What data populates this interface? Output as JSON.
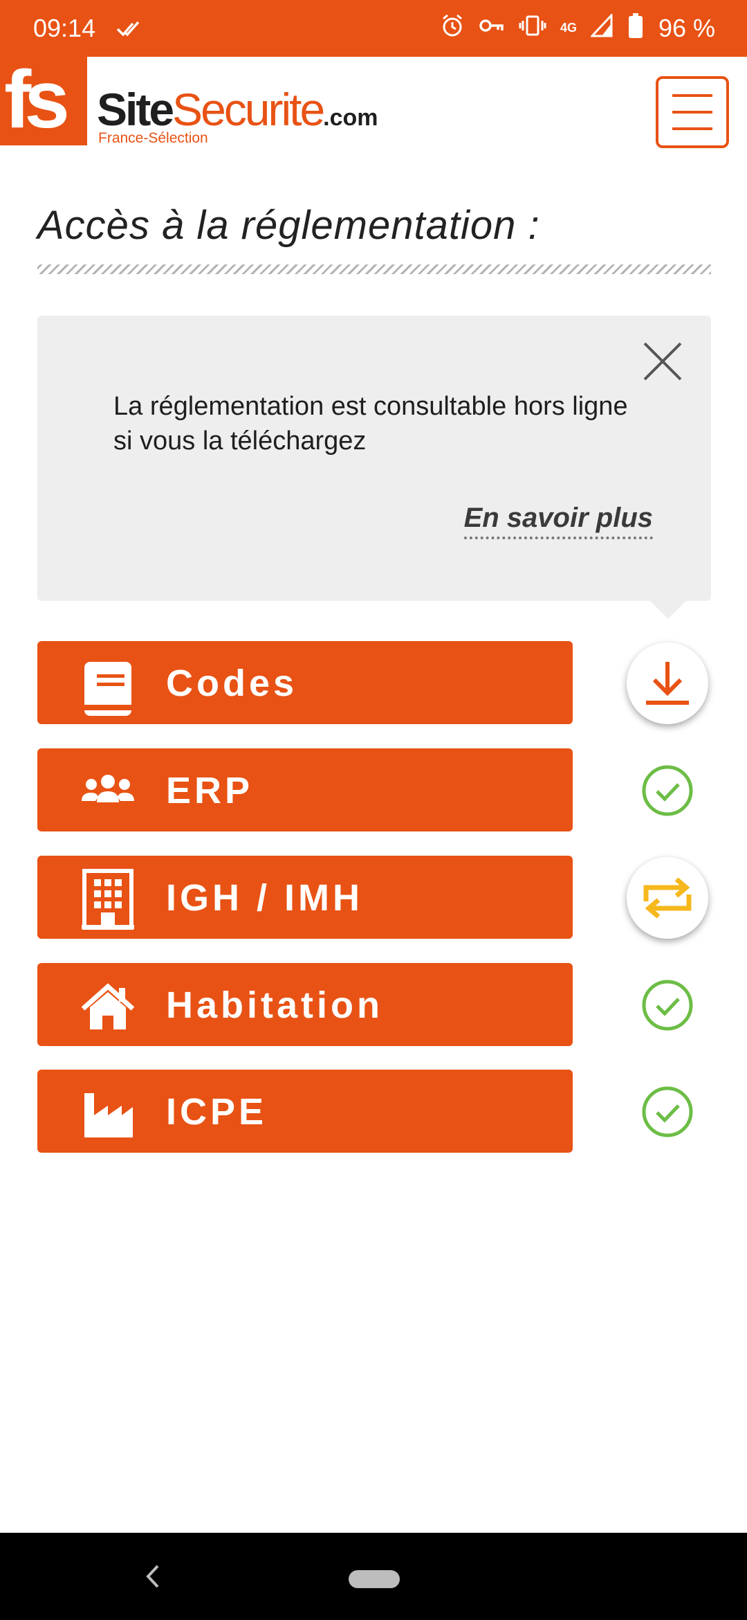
{
  "status_bar": {
    "time": "09:14",
    "network": "4G",
    "battery": "96 %"
  },
  "header": {
    "logo_letters": "fs",
    "brand_site": "Site",
    "brand_securite": "Securite",
    "brand_domain": ".com",
    "brand_subtitle": "France-Sélection",
    "menu_icon": "hamburger-menu-icon"
  },
  "page": {
    "title": "Accès à la réglementation :"
  },
  "info_box": {
    "message": "La réglementation est consultable hors ligne si vous la téléchargez",
    "link": "En savoir plus"
  },
  "categories": [
    {
      "label": "Codes",
      "icon": "book-icon",
      "status": "download"
    },
    {
      "label": "ERP",
      "icon": "users-icon",
      "status": "downloaded"
    },
    {
      "label": "IGH / IMH",
      "icon": "building-icon",
      "status": "sync"
    },
    {
      "label": "Habitation",
      "icon": "house-icon",
      "status": "downloaded"
    },
    {
      "label": "ICPE",
      "icon": "factory-icon",
      "status": "downloaded"
    }
  ],
  "colors": {
    "brand_orange": "#e85214",
    "check_green": "#6cbd45",
    "sync_yellow": "#f6b81c",
    "info_bg": "#eeeeee"
  }
}
